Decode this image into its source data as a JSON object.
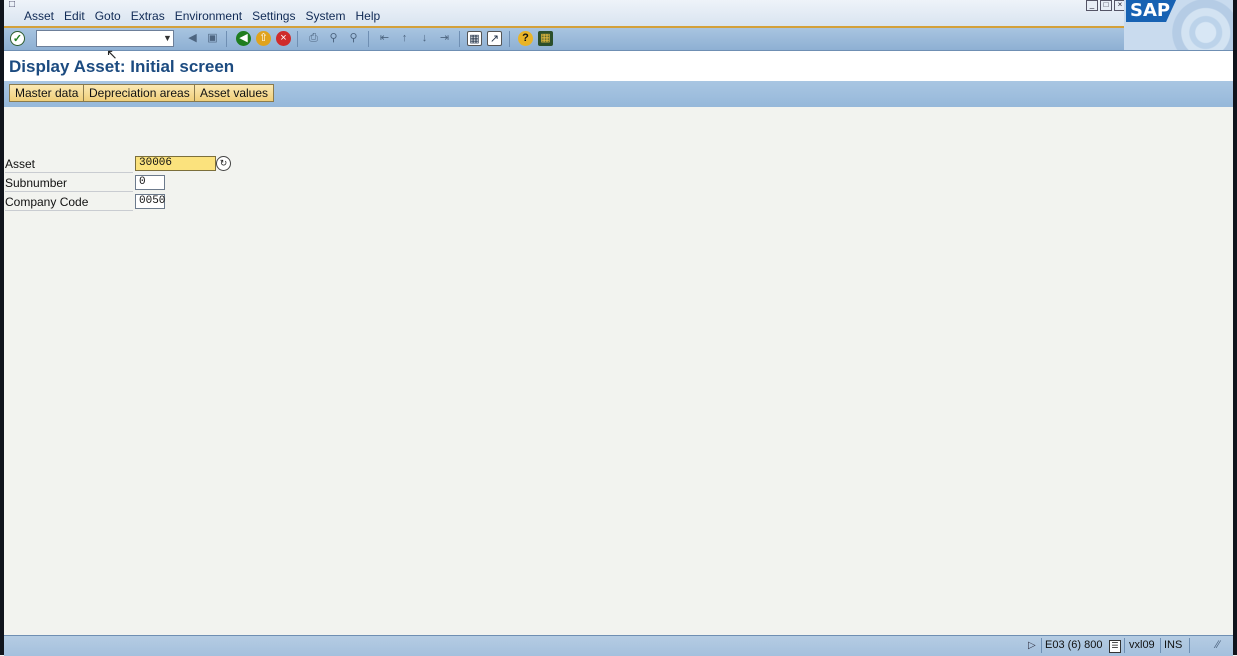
{
  "menu": {
    "items": [
      "Asset",
      "Edit",
      "Goto",
      "Extras",
      "Environment",
      "Settings",
      "System",
      "Help"
    ]
  },
  "window_controls": [
    "minimize-icon",
    "restore-icon",
    "close-icon"
  ],
  "toolbar": {
    "command_field": {
      "value": ""
    },
    "icons": [
      "ok-check-icon",
      "back-icon",
      "exit-icon",
      "cancel-icon",
      "print-icon",
      "find-icon",
      "find-next-icon",
      "first-page-icon",
      "previous-page-icon",
      "next-page-icon",
      "last-page-icon",
      "create-session-icon",
      "shortcut-icon",
      "help-icon",
      "layout-menu-icon"
    ]
  },
  "logo": {
    "text": "SAP"
  },
  "title": "Display Asset: Initial screen",
  "app_toolbar": {
    "buttons": [
      "Master data",
      "Depreciation areas",
      "Asset values"
    ]
  },
  "form": {
    "asset": {
      "label": "Asset",
      "value": "30006"
    },
    "subnumber": {
      "label": "Subnumber",
      "value": "0"
    },
    "company_code": {
      "label": "Company Code",
      "value": "0050"
    }
  },
  "statusbar": {
    "system": "E03 (6) 800",
    "server": "vxl09",
    "mode": "INS"
  },
  "colors": {
    "toolbar_blue": "#8eb0d3",
    "title_text": "#1c4b80",
    "button_yellow": "#f0cf7a",
    "active_field": "#fbe27d"
  }
}
